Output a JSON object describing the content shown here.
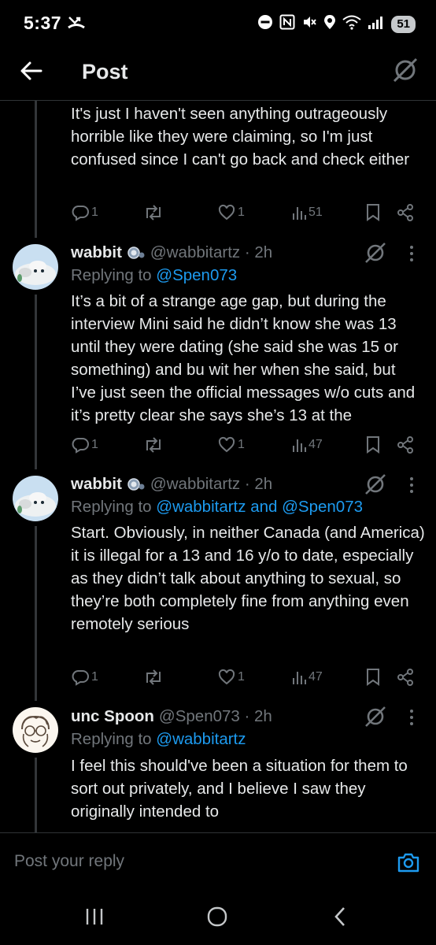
{
  "status_bar": {
    "time": "5:37",
    "battery": "51"
  },
  "header": {
    "title": "Post"
  },
  "tweets": [
    {
      "text": "It's just I haven't seen anything outrageously horrible like they were claiming, so I'm just confused since I can't go back and check either",
      "replies": "1",
      "retweets": "",
      "likes": "1",
      "views": "51"
    },
    {
      "name": "wabbit",
      "handle": "@wabbitartz · 2h",
      "replying_prefix": "Replying to ",
      "replying_to": "@Spen073",
      "text": "It’s a bit of a strange age gap, but during the interview Mini said he didn’t know she was 13 until they were dating (she said she was 15 or something) and bu wit her when she said, but I’ve just seen the official messages w/o cuts and it’s pretty clear she says she’s 13 at the",
      "replies": "1",
      "retweets": "",
      "likes": "1",
      "views": "47"
    },
    {
      "name": "wabbit",
      "handle": "@wabbitartz · 2h",
      "replying_prefix": "Replying to ",
      "replying_to": "@wabbitartz and @Spen073",
      "text": "Start. Obviously, in neither Canada (and America) it is illegal for a 13 and 16 y/o to date, especially as they didn’t talk about anything to sexual, so they’re both completely fine from anything even remotely serious",
      "replies": "1",
      "retweets": "",
      "likes": "1",
      "views": "47"
    },
    {
      "name": "unc Spoon",
      "handle": "@Spen073 · 2h",
      "replying_prefix": "Replying to ",
      "replying_to": "@wabbitartz",
      "text": "I feel this should've been a situation for them to sort out privately, and I believe I saw they originally intended to"
    }
  ],
  "reply_bar": {
    "placeholder": "Post your reply"
  },
  "colors": {
    "background": "#000000",
    "text": "#e7e9ea",
    "secondary": "#71767b",
    "link": "#1d9bf0",
    "divider": "#2f3336"
  },
  "icons": [
    "back-arrow-icon",
    "grok-icon",
    "reply-icon",
    "retweet-icon",
    "like-icon",
    "views-icon",
    "bookmark-icon",
    "share-icon",
    "more-icon",
    "camera-icon",
    "recents-icon",
    "home-icon",
    "back-nav-icon"
  ]
}
